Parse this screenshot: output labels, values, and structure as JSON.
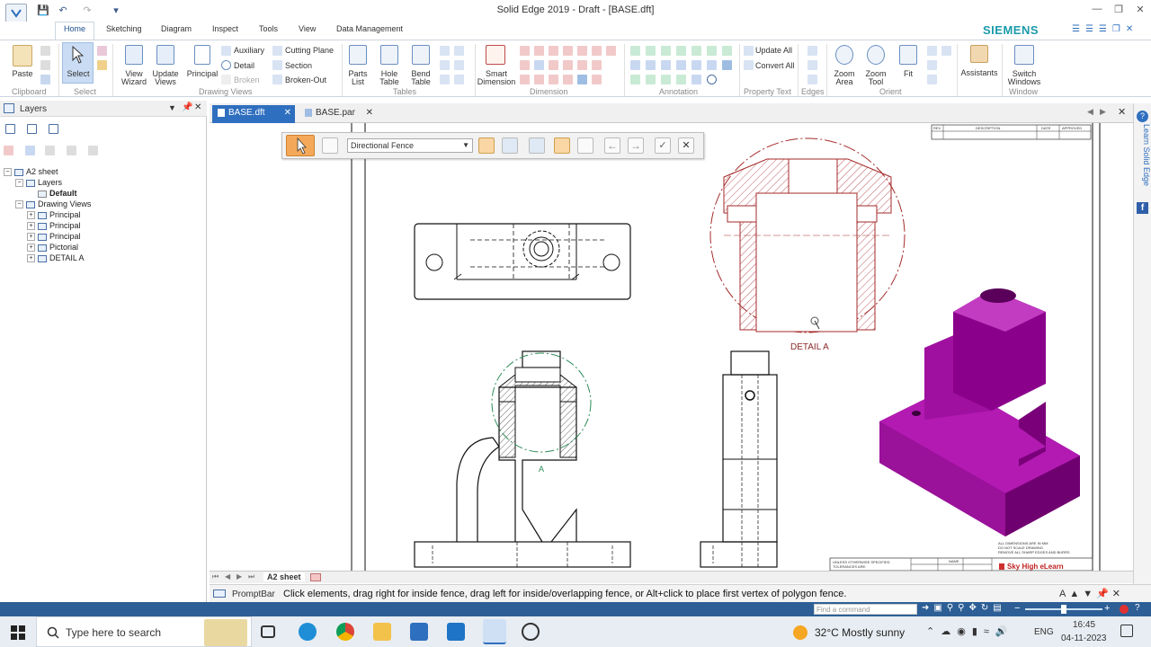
{
  "app": {
    "title": "Solid Edge 2019 - Draft - [BASE.dft]",
    "brand": "SIEMENS",
    "accent": "#2f6fbf"
  },
  "ribbon_tabs": [
    "Home",
    "Sketching",
    "Diagram",
    "Inspect",
    "Tools",
    "View",
    "Data Management"
  ],
  "ribbon": {
    "clipboard": {
      "paste": "Paste",
      "label": "Clipboard"
    },
    "select": {
      "select": "Select",
      "label": "Select"
    },
    "drawing_views": {
      "view_wizard": "View Wizard",
      "update_views": "Update Views",
      "principal": "Principal",
      "auxiliary": "Auxiliary",
      "detail": "Detail",
      "broken": "Broken",
      "cutting_plane": "Cutting Plane",
      "section": "Section",
      "broken_out": "Broken-Out",
      "label": "Drawing Views"
    },
    "tables": {
      "parts_list": "Parts List",
      "hole_table": "Hole Table",
      "bend_table": "Bend Table",
      "label": "Tables"
    },
    "dimension": {
      "smart_dimension": "Smart Dimension",
      "label": "Dimension"
    },
    "annotation": {
      "label": "Annotation"
    },
    "property_text": {
      "update_all": "Update All",
      "convert_all": "Convert All",
      "label": "Property Text"
    },
    "edges": {
      "label": "Edges"
    },
    "orient": {
      "zoom_area": "Zoom Area",
      "zoom_tool": "Zoom Tool",
      "fit": "Fit",
      "label": "Orient"
    },
    "assistants": {
      "label": "Assistants"
    },
    "window": {
      "switch_windows": "Switch Windows",
      "label": "Window"
    }
  },
  "layers_panel": {
    "title": "Layers",
    "tree": [
      {
        "label": "A2 sheet",
        "level": 0
      },
      {
        "label": "Layers",
        "level": 1
      },
      {
        "label": "Default",
        "level": 2,
        "bold": true
      },
      {
        "label": "Drawing Views",
        "level": 1
      },
      {
        "label": "Principal",
        "level": 2
      },
      {
        "label": "Principal",
        "level": 2
      },
      {
        "label": "Principal",
        "level": 2
      },
      {
        "label": "Pictorial",
        "level": 2
      },
      {
        "label": "DETAIL A",
        "level": 2
      }
    ]
  },
  "doc_tabs": [
    {
      "label": "BASE.dft",
      "active": true
    },
    {
      "label": "BASE.par",
      "active": false
    }
  ],
  "fence_toolbar": {
    "mode": "Directional Fence"
  },
  "drawing": {
    "detail_label": "DETAIL A",
    "section_marker": "A",
    "title_block": {
      "rev": "REV",
      "description": "DESCRIPTION",
      "date": "DATE",
      "approved": "APPROVED",
      "note1": "ALL DIMENSIONS ARE IN MM",
      "note2": "DO NOT SCALE DRAWING",
      "note3": "REMOVE ALL SHARP EDGES AND BURRS",
      "tolerance": "UNLESS OTHERWISE SPECIFIED",
      "tolerance2": "TOLERANCES ARE:",
      "name": "NAME",
      "company": "Sky High eLearn"
    }
  },
  "sheet_tab": "A2 sheet",
  "prompt": {
    "label": "PromptBar",
    "text": "Click elements, drag right for inside fence, drag left for inside/overlapping fence, or Alt+click to place first vertex of polygon fence."
  },
  "right_bar": {
    "learn": "Learn Solid Edge"
  },
  "status": {
    "command_placeholder": "Find a command"
  },
  "taskbar": {
    "search": "Type here to search",
    "weather": "32°C  Mostly sunny",
    "lang": "ENG",
    "time": "16:45",
    "date": "04-11-2023"
  }
}
